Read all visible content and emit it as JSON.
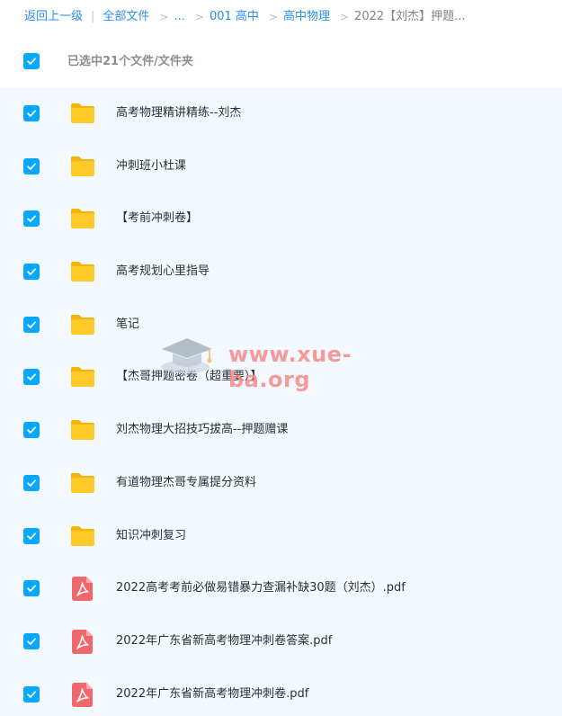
{
  "breadcrumb": {
    "back": "返回上一级",
    "all_files": "全部文件",
    "ellipsis": "...",
    "level1": "001 高中",
    "level2": "高中物理",
    "current": "2022【刘杰】押题...",
    "separator": ">"
  },
  "selection": {
    "label": "已选中21个文件/文件夹",
    "checked": true
  },
  "files": [
    {
      "name": "高考物理精讲精练--刘杰",
      "type": "folder",
      "checked": true
    },
    {
      "name": "冲刺班小杜课",
      "type": "folder",
      "checked": true
    },
    {
      "name": "【考前冲刺卷】",
      "type": "folder",
      "checked": true
    },
    {
      "name": "高考规划心里指导",
      "type": "folder",
      "checked": true
    },
    {
      "name": "笔记",
      "type": "folder",
      "checked": true
    },
    {
      "name": "【杰哥押题密卷（超重要）】",
      "type": "folder",
      "checked": true
    },
    {
      "name": "刘杰物理大招技巧拔高--押题赠课",
      "type": "folder",
      "checked": true
    },
    {
      "name": "有道物理杰哥专属提分资料",
      "type": "folder",
      "checked": true
    },
    {
      "name": "知识冲刺复习",
      "type": "folder",
      "checked": true
    },
    {
      "name": "2022高考考前必做易错暴力查漏补缺30题（刘杰）.pdf",
      "type": "pdf",
      "checked": true
    },
    {
      "name": "2022年广东省新高考物理冲刺卷答案.pdf",
      "type": "pdf",
      "checked": true
    },
    {
      "name": "2022年广东省新高考物理冲刺卷.pdf",
      "type": "pdf",
      "checked": true
    }
  ],
  "watermark": {
    "text": "www.xue-ba.org",
    "icon": "graduation-cap-icon"
  },
  "colors": {
    "link": "#2a8ef0",
    "checkbox": "#06a7ff",
    "list_background": "#f3f9fe",
    "folder": "#ffca28",
    "pdf": "#f2676b"
  }
}
